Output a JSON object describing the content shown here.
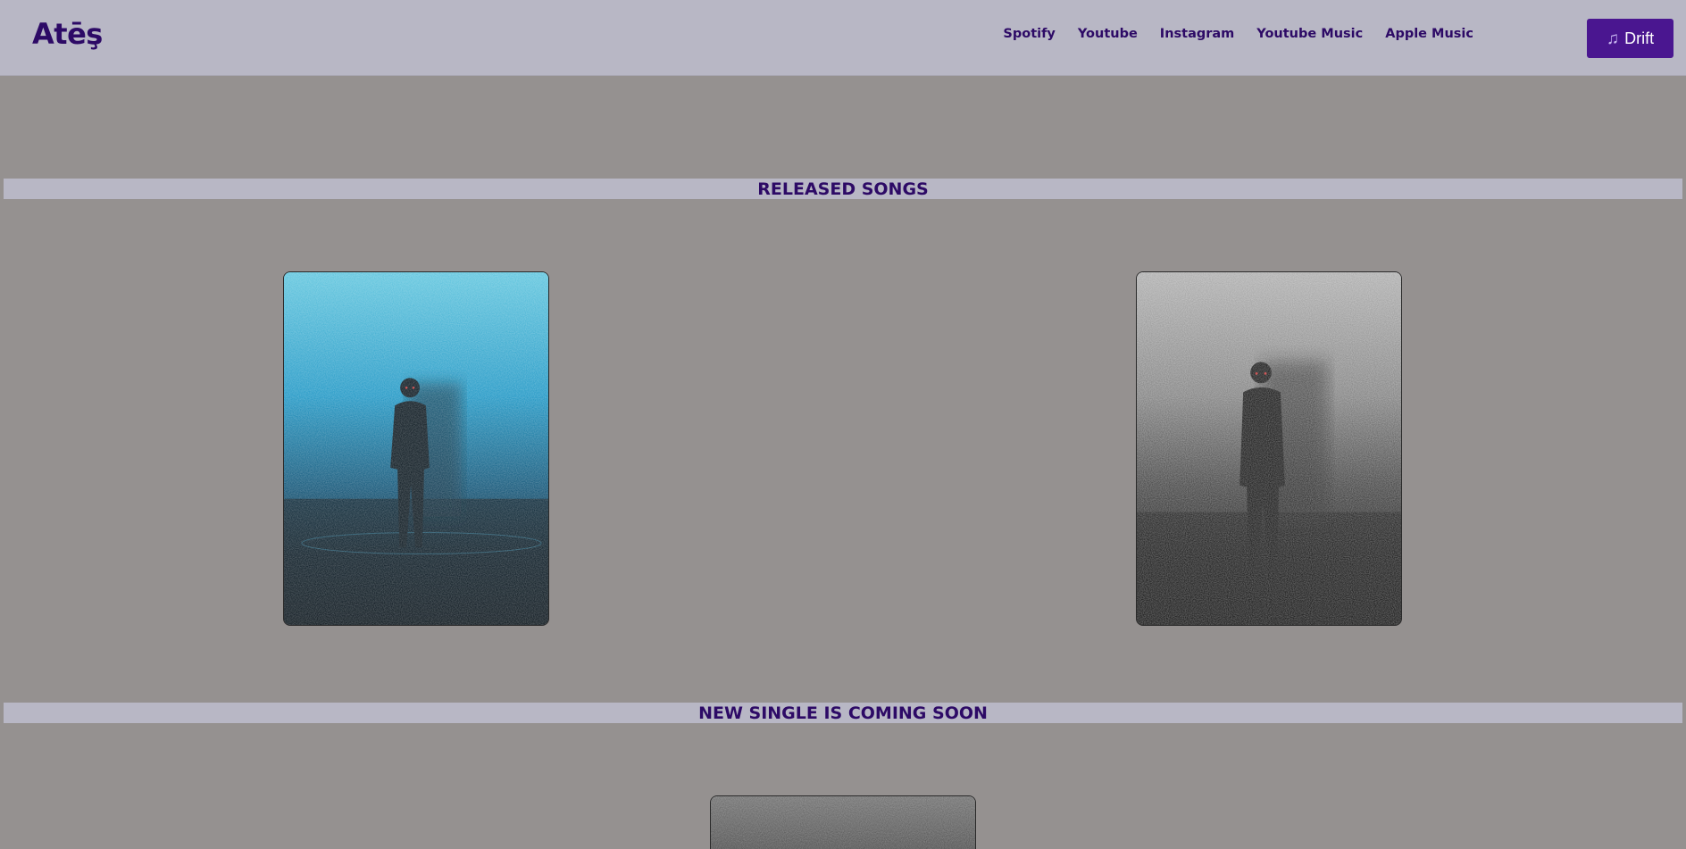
{
  "header": {
    "brand": "Atēş",
    "nav_links": [
      "Spotify",
      "Youtube",
      "Instagram",
      "Youtube Music",
      "Apple Music"
    ],
    "drift_label": "Drift",
    "drift_icon": "music-note-icon"
  },
  "sections": {
    "released_title": "RELEASED SONGS",
    "coming_title": "NEW SINGLE IS COMING SOON"
  },
  "covers": [
    {
      "name": "blue-cover",
      "tone": "#1e9fcf"
    },
    {
      "name": "gray-cover",
      "tone": "#9a9a9a"
    },
    {
      "name": "upcoming-cover",
      "tone": "#5a5a5a"
    }
  ],
  "colors": {
    "accent": "#2d0a66",
    "button": "#4a1690",
    "navbar": "#b8b7c5",
    "background": "#959190"
  }
}
